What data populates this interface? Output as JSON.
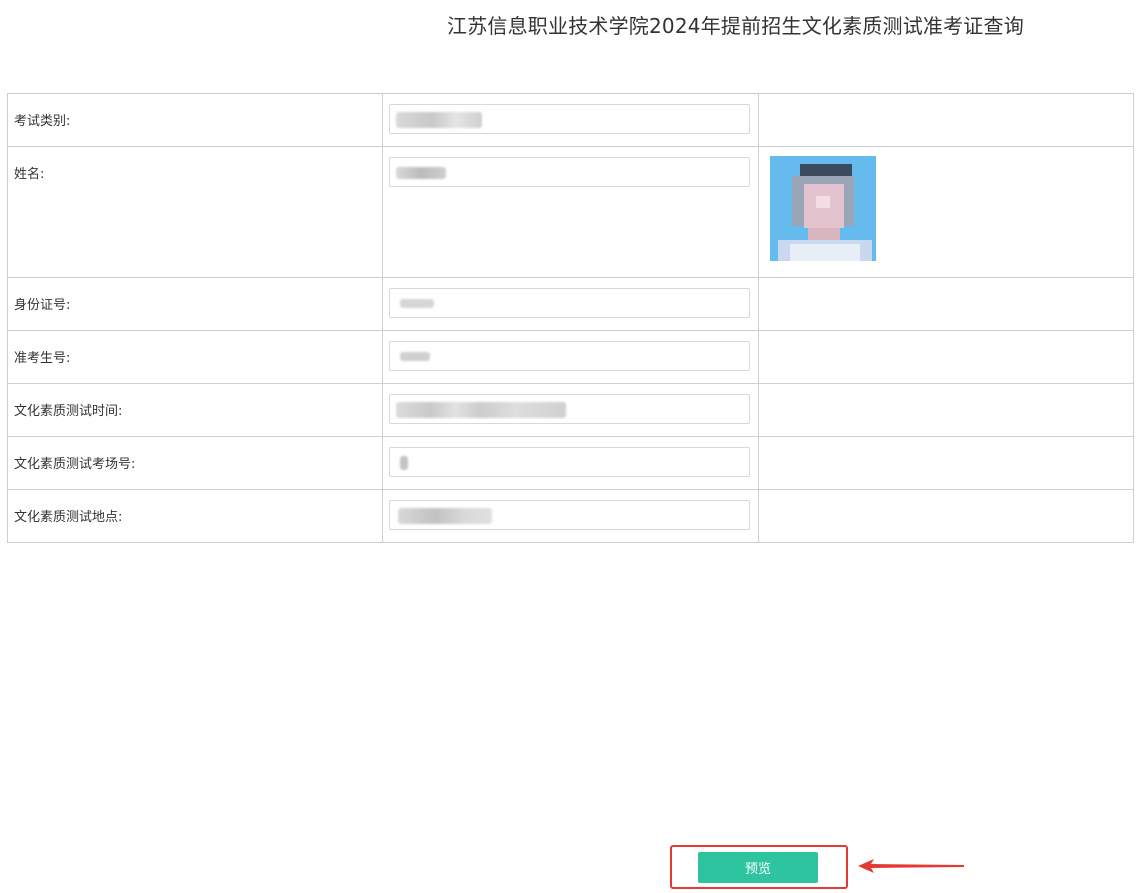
{
  "page": {
    "title": "江苏信息职业技术学院2024年提前招生文化素质测试准考证查询"
  },
  "form": {
    "rows": [
      {
        "label": "考试类别:"
      },
      {
        "label": "姓名:"
      },
      {
        "label": "身份证号:"
      },
      {
        "label": "准考生号:"
      },
      {
        "label": "文化素质测试时间:"
      },
      {
        "label": "文化素质测试考场号:"
      },
      {
        "label": "文化素质测试地点:"
      }
    ]
  },
  "actions": {
    "preview_label": "预览"
  },
  "colors": {
    "button": "#2ec4a0",
    "highlight": "#e53935",
    "photo_background": "#66bbee",
    "border": "#cfcfcf"
  }
}
